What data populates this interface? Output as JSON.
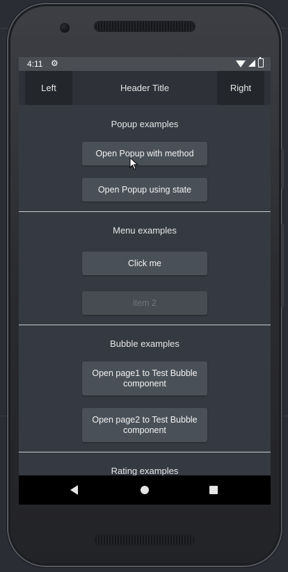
{
  "status_bar": {
    "time": "4:11",
    "icons": [
      "settings-gear-icon",
      "wifi-icon",
      "signal-icon",
      "battery-icon"
    ]
  },
  "header": {
    "left_label": "Left",
    "title": "Header Title",
    "right_label": "Right"
  },
  "sections": {
    "popup": {
      "title": "Popup examples",
      "buttons": [
        "Open Popup with method",
        "Open Popup using state"
      ]
    },
    "menu": {
      "title": "Menu examples",
      "buttons": [
        "Click me",
        "item 2"
      ]
    },
    "bubble": {
      "title": "Bubble examples",
      "buttons": [
        "Open page1 to Test Bubble component",
        "Open page2 to Test Bubble component"
      ]
    },
    "rating": {
      "title": "Rating examples"
    }
  },
  "nav_bar": {
    "icons": [
      "back-icon",
      "home-icon",
      "recent-apps-icon"
    ]
  },
  "colors": {
    "screen_bg": "#353a42",
    "header_bg": "#2e3238",
    "header_button_bg": "#23262b",
    "button_bg": "#4a5058",
    "status_bar_bg": "#4a4d52",
    "nav_bar_bg": "#000000"
  }
}
